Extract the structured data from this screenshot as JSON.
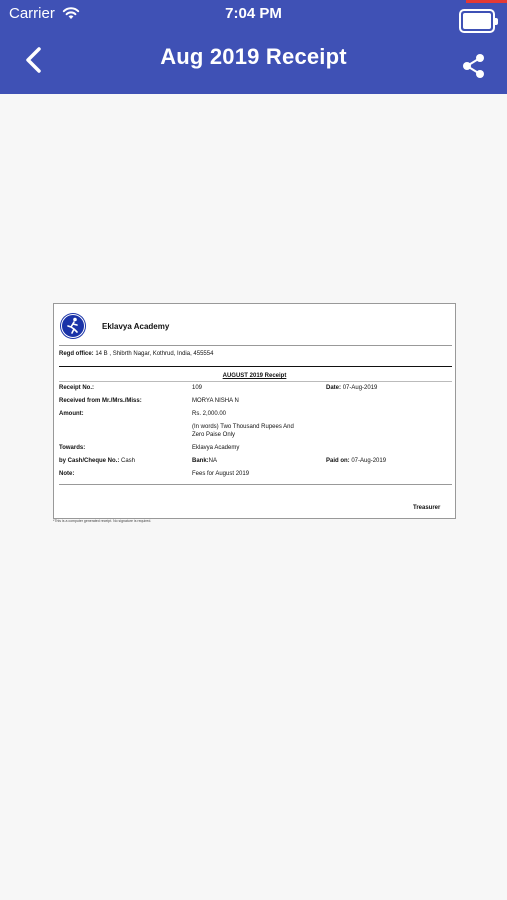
{
  "status_bar": {
    "carrier": "Carrier",
    "time": "7:04 PM",
    "wifi_icon": "wifi-icon",
    "battery_icon": "battery-full-icon"
  },
  "nav": {
    "title": "Aug 2019 Receipt",
    "back_icon": "back-chevron-icon",
    "share_icon": "share-icon"
  },
  "colors": {
    "app_bar": "#3f51b5",
    "logo": "#1a33a8",
    "page_background": "#f7f7f7"
  },
  "receipt": {
    "organization": "Eklavya Academy",
    "regd_label": "Regd office:",
    "regd_address": "14 B , Shibrth Nagar, Kothrud, India, 455554",
    "title": "AUGUST 2019 Receipt",
    "receipt_no_label": "Receipt No.:",
    "receipt_no": "109",
    "date_label": "Date:",
    "date": "07-Aug-2019",
    "received_from_label": "Received from Mr./Mrs./Miss:",
    "received_from": "MORYA NISHA N",
    "amount_label": "Amount:",
    "amount": "Rs. 2,000.00",
    "amount_words_line1": "(In words) Two Thousand Rupees And",
    "amount_words_line2": "Zero Paise Only",
    "towards_label": "Towards:",
    "towards": "Eklavya Academy",
    "payment_mode_label": "by Cash/Cheque No.:",
    "payment_mode": "Cash",
    "bank_label": "Bank:",
    "bank": "NA",
    "paid_on_label": "Paid on:",
    "paid_on": "07-Aug-2019",
    "note_label": "Note:",
    "note": "Fees for August 2019",
    "treasurer": "Treasurer",
    "footnote": "*This is a computer generated receipt. No signature is required."
  }
}
